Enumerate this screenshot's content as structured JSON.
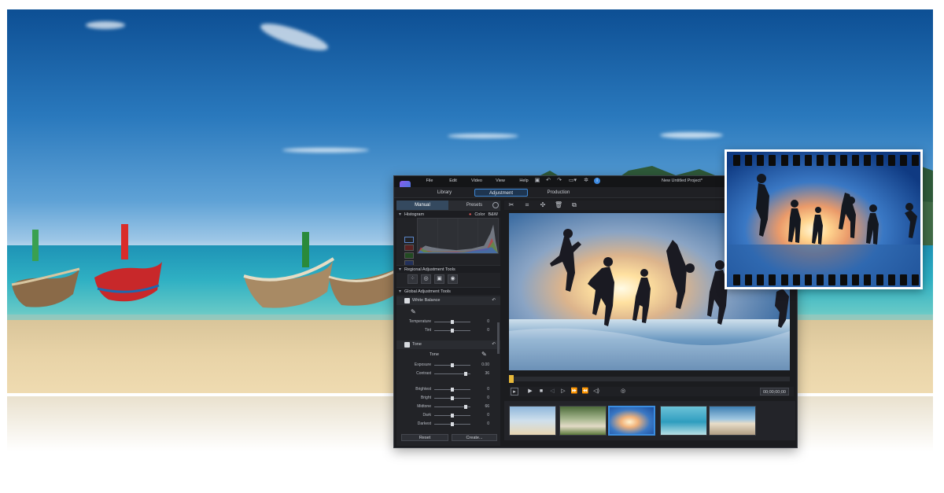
{
  "app": {
    "menu": [
      "File",
      "Edit",
      "Video",
      "View",
      "Help"
    ],
    "project_title": "New Untitled Project*",
    "modes": [
      "Library",
      "Adjustment",
      "Production"
    ],
    "active_mode": "Adjustment",
    "left_panel": {
      "tabs": [
        "Manual",
        "Presets"
      ],
      "active_tab": "Manual",
      "histogram": {
        "title": "Histogram",
        "color_label": "Color",
        "bw_label": "B&W"
      },
      "regional_title": "Regional Adjustment Tools",
      "global_title": "Global Adjustment Tools",
      "white_balance": {
        "title": "White Balance",
        "sliders": [
          {
            "label": "Temperature",
            "value": "0",
            "pos": 0.5
          },
          {
            "label": "Tint",
            "value": "0",
            "pos": 0.5
          }
        ]
      },
      "tone": {
        "title": "Tone",
        "subtitle": "Tone",
        "sliders": [
          {
            "label": "Exposure",
            "value": "0.00",
            "pos": 0.5
          },
          {
            "label": "Contrast",
            "value": "36",
            "pos": 0.86
          }
        ],
        "sliders2": [
          {
            "label": "Brightest",
            "value": "0",
            "pos": 0.5
          },
          {
            "label": "Bright",
            "value": "0",
            "pos": 0.5
          },
          {
            "label": "Midtone",
            "value": "66",
            "pos": 0.86
          },
          {
            "label": "Dark",
            "value": "0",
            "pos": 0.5
          },
          {
            "label": "Darkest",
            "value": "0",
            "pos": 0.5
          }
        ]
      },
      "reset_label": "Reset",
      "create_label": "Create..."
    },
    "timecode": "00;00;00;00"
  }
}
